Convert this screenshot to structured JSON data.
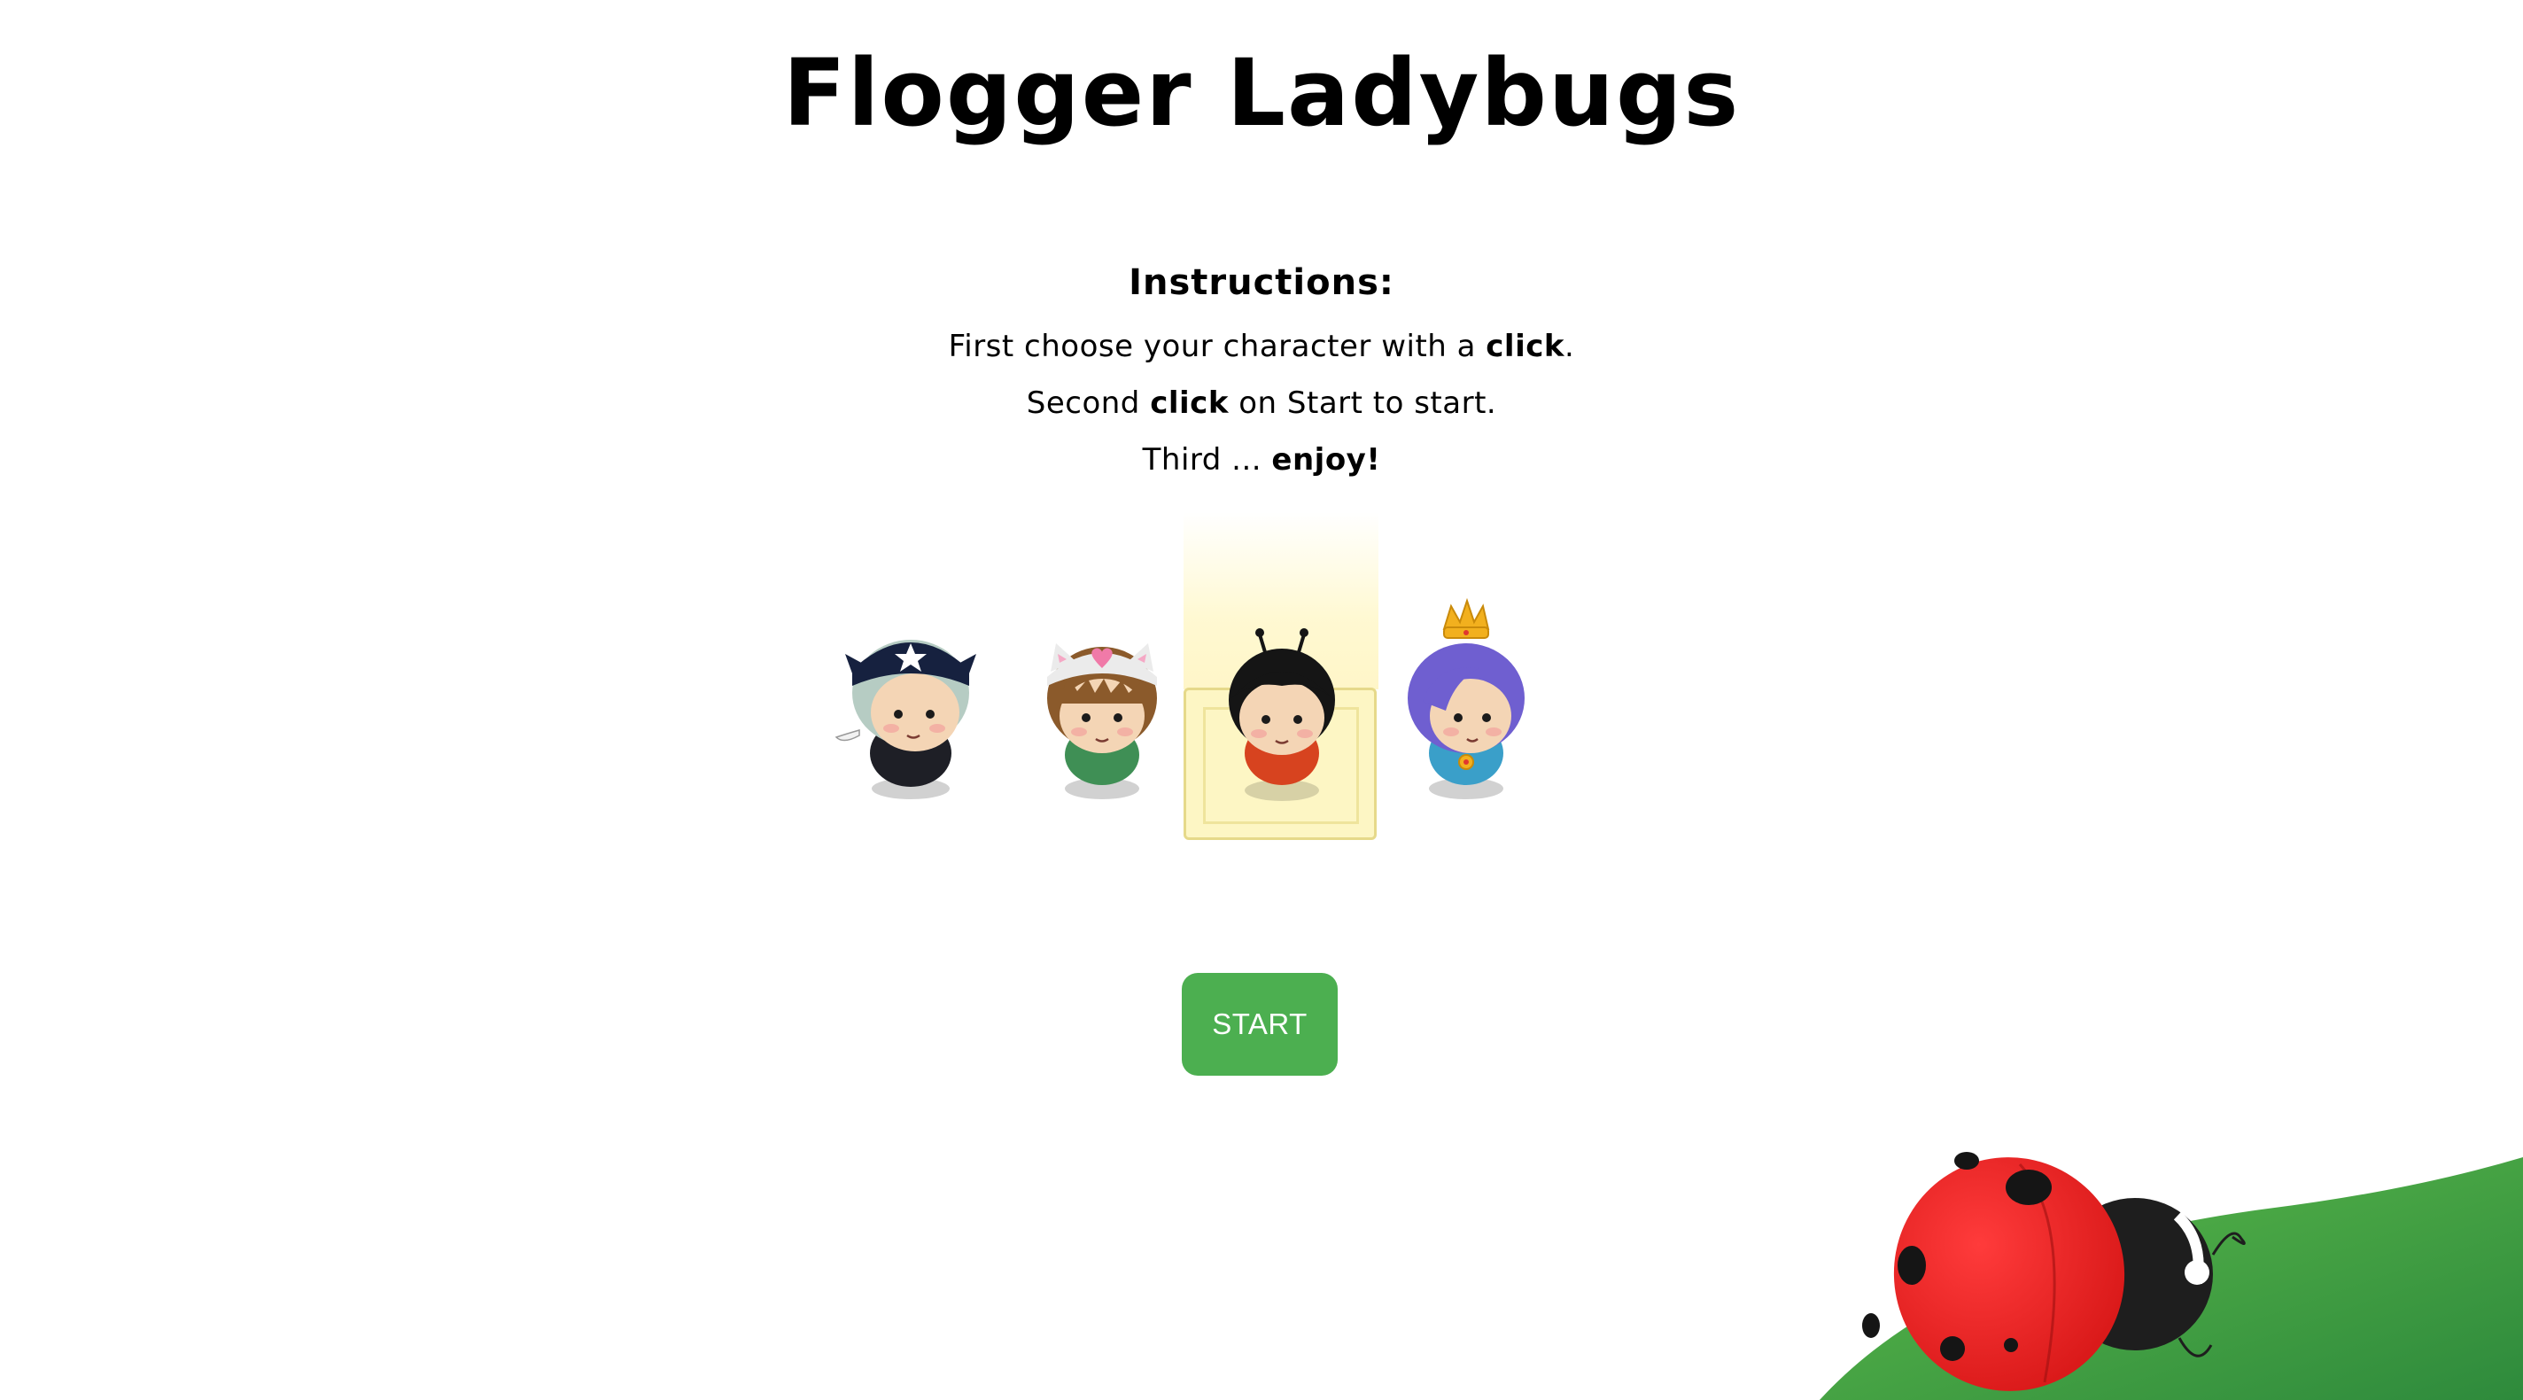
{
  "page": {
    "title": "Flogger Ladybugs"
  },
  "instructions": {
    "heading": "Instructions:",
    "line1_pre": "First choose your character with a ",
    "line1_bold": "click",
    "line1_post": ".",
    "line2_pre": "Second ",
    "line2_bold": "click",
    "line2_post": " on Start to start.",
    "line3_pre": "Third ... ",
    "line3_bold": "enjoy!"
  },
  "characters": [
    {
      "id": "pirate",
      "icon": "pirate-character-icon",
      "selected": false
    },
    {
      "id": "cat-hat",
      "icon": "cat-hat-character-icon",
      "selected": false
    },
    {
      "id": "ladybug",
      "icon": "ladybug-character-icon",
      "selected": true
    },
    {
      "id": "princess",
      "icon": "princess-character-icon",
      "selected": false
    }
  ],
  "start_button": {
    "label": "START"
  },
  "colors": {
    "accent": "#4caf50",
    "selection_fill": "#fdf6c4",
    "ladybug_red": "#f22a2a",
    "leaf_green": "#4caf50"
  }
}
